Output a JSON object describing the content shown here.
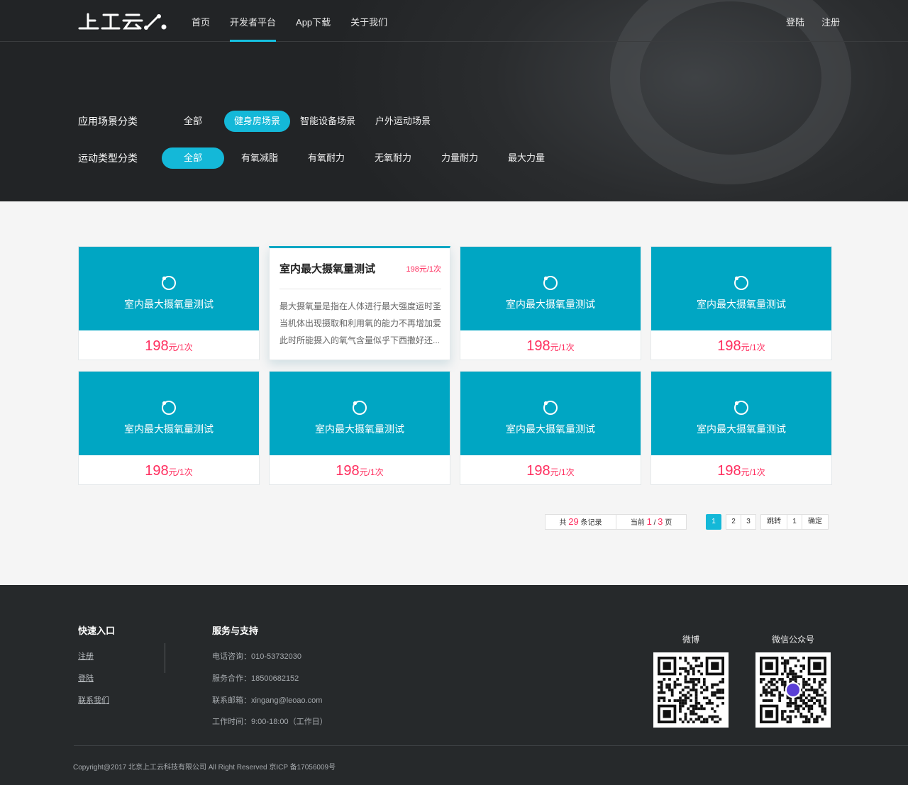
{
  "brand": {
    "logo_text": "上工云"
  },
  "nav": {
    "items": [
      {
        "label": "首页"
      },
      {
        "label": "开发者平台",
        "active": true
      },
      {
        "label": "App下载"
      },
      {
        "label": "关于我们"
      }
    ],
    "login": "登陆",
    "register": "注册"
  },
  "filters": {
    "scene": {
      "label": "应用场景分类",
      "options": [
        "全部",
        "健身房场景",
        "智能设备场景",
        "户外运动场景"
      ],
      "selected": "健身房场景"
    },
    "sport": {
      "label": "运动类型分类",
      "options": [
        "全部",
        "有氧减脂",
        "有氧耐力",
        "无氧耐力",
        "力量耐力",
        "最大力量"
      ],
      "selected": "全部"
    }
  },
  "cards": [
    {
      "title": "室内最大摄氧量测试",
      "price": "198",
      "unit": "元/1次"
    },
    {
      "title": "室内最大摄氧量测试",
      "price": "198",
      "unit": "元/1次",
      "expanded": true,
      "detail_price": "198元/1次",
      "description": "最大摄氧量是指在人体进行最大强度运时圣当机体出现摄取和利用氧的能力不再增加爱此时所能摄入的氧气含量似乎下西撒好还..."
    },
    {
      "title": "室内最大摄氧量测试",
      "price": "198",
      "unit": "元/1次"
    },
    {
      "title": "室内最大摄氧量测试",
      "price": "198",
      "unit": "元/1次"
    },
    {
      "title": "室内最大摄氧量测试",
      "price": "198",
      "unit": "元/1次"
    },
    {
      "title": "室内最大摄氧量测试",
      "price": "198",
      "unit": "元/1次"
    },
    {
      "title": "室内最大摄氧量测试",
      "price": "198",
      "unit": "元/1次"
    },
    {
      "title": "室内最大摄氧量测试",
      "price": "198",
      "unit": "元/1次"
    }
  ],
  "pagination": {
    "total_prefix": "共",
    "total": "29",
    "total_suffix": "条记录",
    "current_prefix": "当前",
    "current": "1",
    "separator": "/",
    "pages_total": "3",
    "current_suffix": "页",
    "pages": [
      "1",
      "2",
      "3"
    ],
    "active_page": "1",
    "jump_label": "跳转",
    "jump_value": "1",
    "confirm_label": "确定"
  },
  "footer": {
    "quick": {
      "title": "快速入口",
      "links": [
        "注册",
        "登陆",
        "联系我们"
      ]
    },
    "service": {
      "title": "服务与支持",
      "lines": [
        "电话咨询：010-53732030",
        "服务合作：18500682152",
        "联系邮箱：xingang@leoao.com",
        "工作时间：9:00-18:00（工作日）"
      ]
    },
    "weibo_label": "微博",
    "wechat_label": "微信公众号",
    "copyright": "Copyright@2017 北京上工云科技有限公司 All Right Reserved 京ICP 备17056009号"
  },
  "colors": {
    "accent": "#14b8d8",
    "card_blue": "#00a6c3",
    "price": "#ff2d5e",
    "dark_bg": "#26292b"
  },
  "icons": {
    "card": "circle-orbit-icon",
    "qr": "qr-code-icon"
  }
}
